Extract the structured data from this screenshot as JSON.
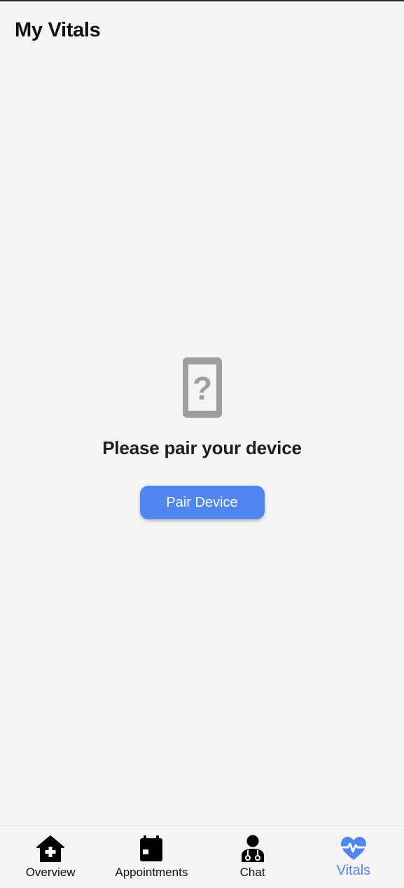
{
  "header": {
    "title": "My Vitals"
  },
  "empty_state": {
    "icon": "device-unknown-icon",
    "message": "Please pair your device",
    "button_label": "Pair Device"
  },
  "nav": {
    "items": [
      {
        "label": "Overview",
        "icon": "home-plus-icon",
        "active": false
      },
      {
        "label": "Appointments",
        "icon": "calendar-icon",
        "active": false
      },
      {
        "label": "Chat",
        "icon": "doctor-icon",
        "active": false
      },
      {
        "label": "Vitals",
        "icon": "heart-pulse-icon",
        "active": true
      }
    ]
  },
  "colors": {
    "accent": "#4f86f0",
    "background": "#f4f4f4",
    "icon_gray": "#9e9e9e"
  }
}
